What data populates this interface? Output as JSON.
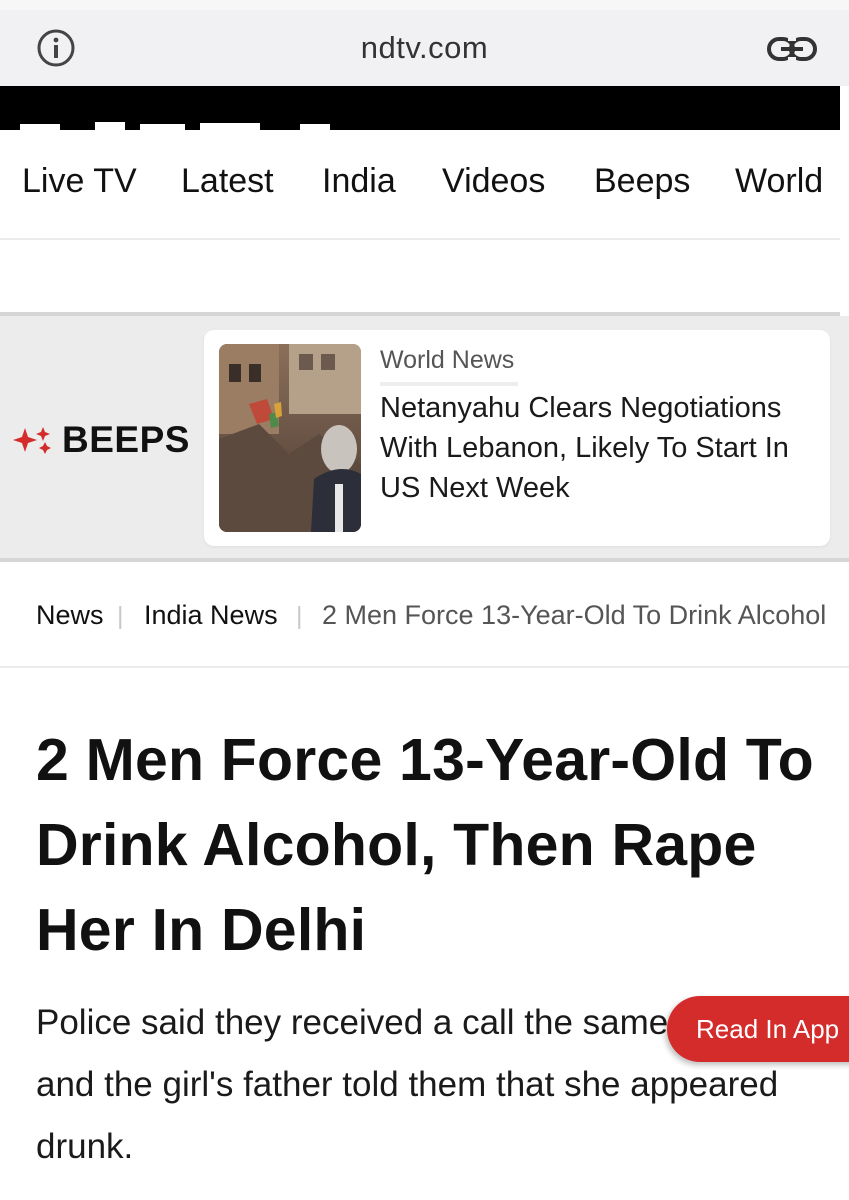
{
  "browser": {
    "url": "ndtv.com",
    "info_icon": "info-icon",
    "link_icon": "link-icon"
  },
  "nav": {
    "items": [
      "Live TV",
      "Latest",
      "India",
      "Videos",
      "Beeps",
      "World"
    ]
  },
  "beeps": {
    "brand": "BEEPS",
    "brand_color": "#d42b2b",
    "card": {
      "category": "World News",
      "headline": "Netanyahu Clears Negotiations With Lebanon, Likely To Start In US Next Week"
    }
  },
  "breadcrumb": {
    "items": [
      "News",
      "India News",
      "2 Men Force 13-Year-Old To Drink Alcohol"
    ]
  },
  "article": {
    "title": "2 Men Force 13-Year-Old To Drink Alcohol, Then Rape Her In Delhi",
    "summary": "Police said they received a call the same evening and the girl's father told them that she appeared drunk."
  },
  "cta": {
    "label": "Read In App",
    "color": "#d42b2b"
  }
}
